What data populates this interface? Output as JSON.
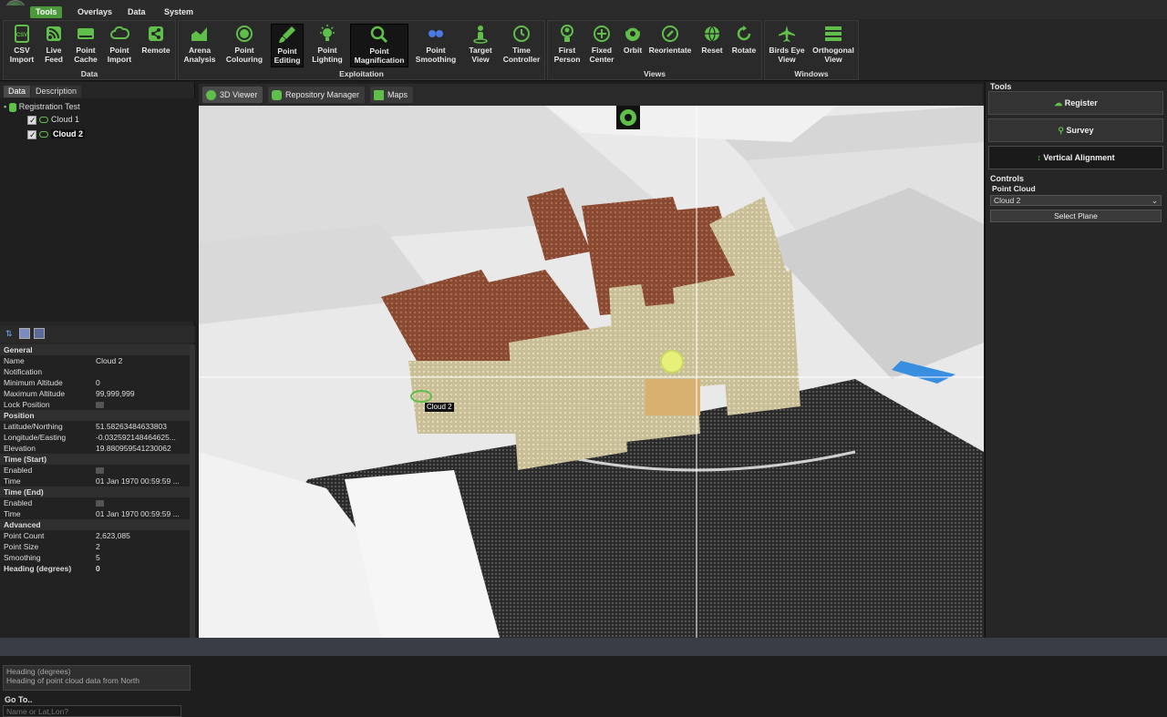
{
  "menu": {
    "tabs": [
      "Tools",
      "Overlays",
      "Data",
      "System"
    ],
    "active": "Tools"
  },
  "ribbon": {
    "groups": {
      "data": "Data",
      "exploitation": "Exploitation",
      "views": "Views",
      "windows": "Windows"
    },
    "buttons": {
      "csv_import": [
        "CSV",
        "Import"
      ],
      "live_feed": [
        "Live",
        "Feed"
      ],
      "point_cache": [
        "Point",
        "Cache"
      ],
      "point_import": [
        "Point",
        "Import"
      ],
      "remote": [
        "Remote",
        ""
      ],
      "arena_analysis": [
        "Arena",
        "Analysis"
      ],
      "point_colouring": [
        "Point",
        "Colouring"
      ],
      "point_editing": [
        "Point",
        "Editing"
      ],
      "point_lighting": [
        "Point",
        "Lighting"
      ],
      "point_magnification": [
        "Point",
        "Magnification"
      ],
      "point_smoothing": [
        "Point",
        "Smoothing"
      ],
      "target_view": [
        "Target",
        "View"
      ],
      "time_controller": [
        "Time",
        "Controller"
      ],
      "first_person": [
        "First",
        "Person"
      ],
      "fixed_center": [
        "Fixed",
        "Center"
      ],
      "orbit": [
        "Orbit",
        ""
      ],
      "reorientate": [
        "Reorientate",
        ""
      ],
      "reset": [
        "Reset",
        ""
      ],
      "rotate": [
        "Rotate",
        ""
      ],
      "birds_eye_view": [
        "Birds Eye",
        "View"
      ],
      "orthogonal_view": [
        "Orthogonal",
        "View"
      ]
    }
  },
  "left_panel": {
    "tabs": [
      "Data",
      "Description"
    ],
    "tree": {
      "root": "Registration Test",
      "items": [
        "Cloud 1",
        "Cloud 2"
      ]
    },
    "properties": [
      {
        "type": "section",
        "label": "General"
      },
      {
        "label": "Name",
        "value": "Cloud 2"
      },
      {
        "label": "Notification",
        "value": ""
      },
      {
        "label": "Minimum Altitude",
        "value": "0"
      },
      {
        "label": "Maximum Altitude",
        "value": "99,999,999"
      },
      {
        "label": "Lock Position",
        "value": "",
        "toggle": true
      },
      {
        "type": "section",
        "label": "Position"
      },
      {
        "label": "Latitude/Northing",
        "value": "51.58263484633803"
      },
      {
        "label": "Longitude/Easting",
        "value": "-0.032592148464625..."
      },
      {
        "label": "Elevation",
        "value": "19.880959541230062"
      },
      {
        "type": "section",
        "label": "Time (Start)"
      },
      {
        "label": "Enabled",
        "value": "",
        "toggle": true
      },
      {
        "label": "Time",
        "value": "01 Jan 1970 00:59:59 ..."
      },
      {
        "type": "section",
        "label": "Time (End)"
      },
      {
        "label": "Enabled",
        "value": "",
        "toggle": true
      },
      {
        "label": "Time",
        "value": "01 Jan 1970 00:59:59 ..."
      },
      {
        "type": "section",
        "label": "Advanced"
      },
      {
        "label": "Point Count",
        "value": "2,623,085"
      },
      {
        "label": "Point Size",
        "value": "2"
      },
      {
        "label": "Smoothing",
        "value": "5"
      },
      {
        "label": "Heading (degrees)",
        "value": "0",
        "bold": true
      }
    ],
    "help": {
      "title": "Heading (degrees)",
      "text": "Heading of point cloud data from North"
    },
    "goto": {
      "label": "Go To..",
      "placeholder": "Name or Lat,Lon?"
    }
  },
  "viewer": {
    "tabs": [
      "3D Viewer",
      "Repository Manager",
      "Maps"
    ],
    "active": "3D Viewer",
    "cloud_label": "Cloud 2"
  },
  "right_panel": {
    "title": "Tools",
    "buttons": [
      "Register",
      "Survey",
      "Vertical Alignment"
    ],
    "controls_title": "Controls",
    "point_cloud_label": "Point Cloud",
    "selected_cloud": "Cloud 2",
    "select_plane": "Select Plane"
  },
  "colors": {
    "accent": "#4a9a3c",
    "icon_green": "#5fbf4a",
    "panel_bg": "#262626"
  }
}
